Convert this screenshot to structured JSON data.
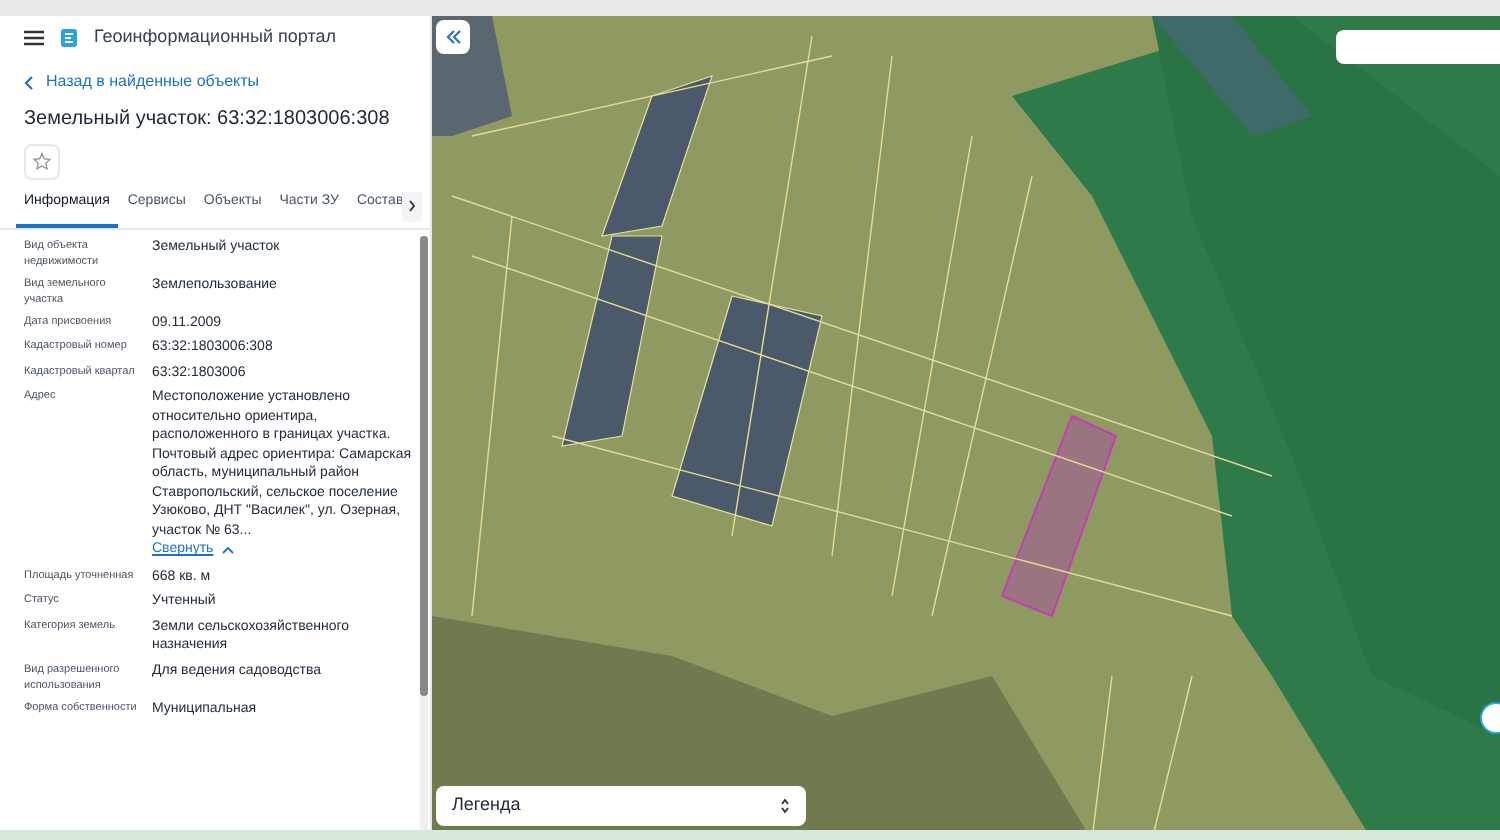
{
  "app": {
    "title": "Геоинформационный портал"
  },
  "back_link": "Назад в найденные объекты",
  "object_title": "Земельный участок: 63:32:1803006:308",
  "favorite": {
    "on": false
  },
  "tabs": [
    {
      "label": "Информация",
      "selected": true
    },
    {
      "label": "Сервисы",
      "selected": false
    },
    {
      "label": "Объекты",
      "selected": false
    },
    {
      "label": "Части ЗУ",
      "selected": false
    },
    {
      "label": "Состав",
      "selected": false
    }
  ],
  "properties": [
    {
      "label": "Вид объекта недвижимости",
      "value": "Земельный участок"
    },
    {
      "label": "Вид земельного участка",
      "value": "Землепользование"
    },
    {
      "label": "Дата присвоения",
      "value": "09.11.2009"
    },
    {
      "label": "Кадастровый номер",
      "value": "63:32:1803006:308"
    },
    {
      "label": "Кадастровый квартал",
      "value": "63:32:1803006"
    },
    {
      "label": "Адрес",
      "value": "Местоположение установлено относительно ориентира, расположенного в границах участка. Почтовый адрес ориентира: Самарская область, муниципальный район Ставропольский, сельское поселение Узюково, ДНТ \"Василек\", ул. Озерная, участок № 63...",
      "link": "Свернуть"
    },
    {
      "label": "Площадь уточненная",
      "value": "668 кв. м"
    },
    {
      "label": "Статус",
      "value": "Учтенный"
    },
    {
      "label": "Категория земель",
      "value": "Земли сельскохозяйственного назначения"
    },
    {
      "label": "Вид разрешенного использования",
      "value": "Для ведения садоводства"
    },
    {
      "label": "Форма собственности",
      "value": "Муниципальная"
    }
  ],
  "map": {
    "legend": "Легенда"
  }
}
